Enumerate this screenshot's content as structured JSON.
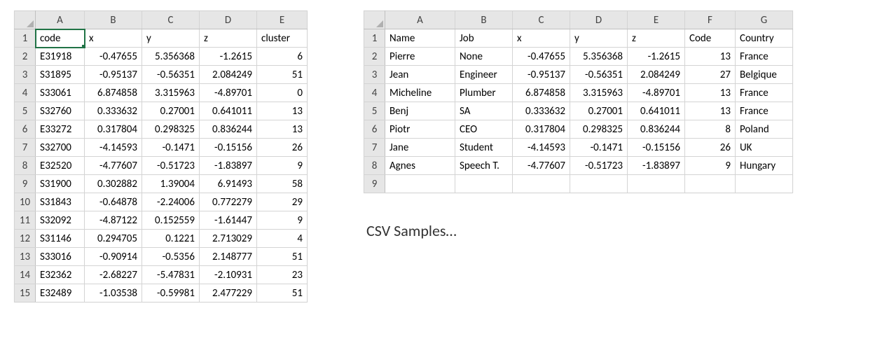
{
  "caption": "CSV Samples…",
  "left": {
    "cols": [
      "A",
      "B",
      "C",
      "D",
      "E"
    ],
    "selected_cell": "A1",
    "rows": [
      {
        "n": 1,
        "A": "code",
        "B": "x",
        "C": "y",
        "D": "z",
        "E": "cluster"
      },
      {
        "n": 2,
        "A": "E31918",
        "B": "-0.47655",
        "C": "5.356368",
        "D": "-1.2615",
        "E": "6"
      },
      {
        "n": 3,
        "A": "S31895",
        "B": "-0.95137",
        "C": "-0.56351",
        "D": "2.084249",
        "E": "51"
      },
      {
        "n": 4,
        "A": "S33061",
        "B": "6.874858",
        "C": "3.315963",
        "D": "-4.89701",
        "E": "0"
      },
      {
        "n": 5,
        "A": "S32760",
        "B": "0.333632",
        "C": "0.27001",
        "D": "0.641011",
        "E": "13"
      },
      {
        "n": 6,
        "A": "E33272",
        "B": "0.317804",
        "C": "0.298325",
        "D": "0.836244",
        "E": "13"
      },
      {
        "n": 7,
        "A": "S32700",
        "B": "-4.14593",
        "C": "-0.1471",
        "D": "-0.15156",
        "E": "26"
      },
      {
        "n": 8,
        "A": "E32520",
        "B": "-4.77607",
        "C": "-0.51723",
        "D": "-1.83897",
        "E": "9"
      },
      {
        "n": 9,
        "A": "S31900",
        "B": "0.302882",
        "C": "1.39004",
        "D": "6.91493",
        "E": "58"
      },
      {
        "n": 10,
        "A": "S31843",
        "B": "-0.64878",
        "C": "-2.24006",
        "D": "0.772279",
        "E": "29"
      },
      {
        "n": 11,
        "A": "S32092",
        "B": "-4.87122",
        "C": "0.152559",
        "D": "-1.61447",
        "E": "9"
      },
      {
        "n": 12,
        "A": "S31146",
        "B": "0.294705",
        "C": "0.1221",
        "D": "2.713029",
        "E": "4"
      },
      {
        "n": 13,
        "A": "S33016",
        "B": "-0.90914",
        "C": "-0.5356",
        "D": "2.148777",
        "E": "51"
      },
      {
        "n": 14,
        "A": "E32362",
        "B": "-2.68227",
        "C": "-5.47831",
        "D": "-2.10931",
        "E": "23"
      },
      {
        "n": 15,
        "A": "E32489",
        "B": "-1.03538",
        "C": "-0.59981",
        "D": "2.477229",
        "E": "51"
      }
    ],
    "numeric_cols": {
      "B": true,
      "C": true,
      "D": true,
      "E": true
    }
  },
  "right": {
    "cols": [
      "A",
      "B",
      "C",
      "D",
      "E",
      "F",
      "G"
    ],
    "rows": [
      {
        "n": 1,
        "A": "Name",
        "B": "Job",
        "C": "x",
        "D": "y",
        "E": "z",
        "F": "Code",
        "G": "Country"
      },
      {
        "n": 2,
        "A": "Pierre",
        "B": "None",
        "C": "-0.47655",
        "D": "5.356368",
        "E": "-1.2615",
        "F": "13",
        "G": "France"
      },
      {
        "n": 3,
        "A": "Jean",
        "B": "Engineer",
        "C": "-0.95137",
        "D": "-0.56351",
        "E": "2.084249",
        "F": "27",
        "G": "Belgique"
      },
      {
        "n": 4,
        "A": "Micheline",
        "B": "Plumber",
        "C": "6.874858",
        "D": "3.315963",
        "E": "-4.89701",
        "F": "13",
        "G": "France"
      },
      {
        "n": 5,
        "A": "Benj",
        "B": "SA",
        "C": "0.333632",
        "D": "0.27001",
        "E": "0.641011",
        "F": "13",
        "G": "France"
      },
      {
        "n": 6,
        "A": "Piotr",
        "B": "CEO",
        "C": "0.317804",
        "D": "0.298325",
        "E": "0.836244",
        "F": "8",
        "G": "Poland"
      },
      {
        "n": 7,
        "A": "Jane",
        "B": "Student",
        "C": "-4.14593",
        "D": "-0.1471",
        "E": "-0.15156",
        "F": "26",
        "G": "UK"
      },
      {
        "n": 8,
        "A": "Agnes",
        "B": "Speech T.",
        "C": "-4.77607",
        "D": "-0.51723",
        "E": "-1.83897",
        "F": "9",
        "G": "Hungary"
      },
      {
        "n": 9,
        "A": "",
        "B": "",
        "C": "",
        "D": "",
        "E": "",
        "F": "",
        "G": ""
      }
    ],
    "numeric_cols": {
      "C": true,
      "D": true,
      "E": true,
      "F": true
    }
  }
}
